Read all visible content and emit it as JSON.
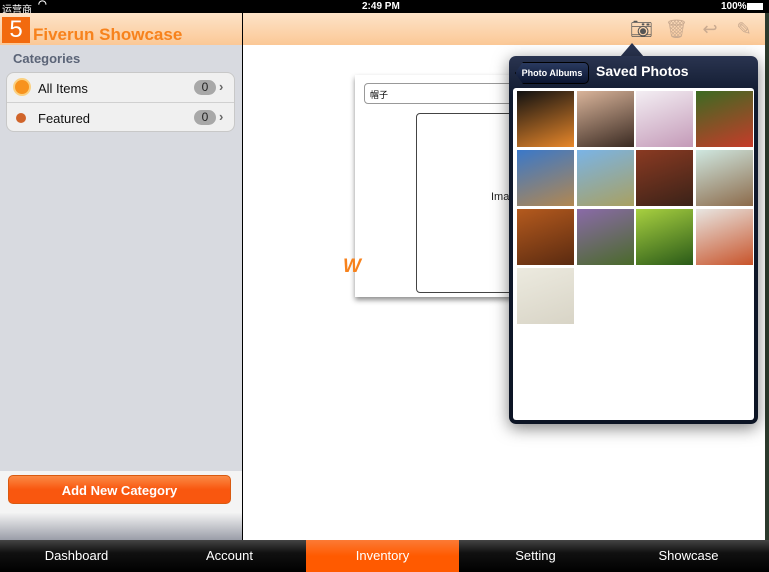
{
  "status_bar": {
    "carrier": "运营商",
    "time": "2:49 PM",
    "battery": "100%"
  },
  "sidebar": {
    "logo": "5",
    "app_title": "Fiverun Showcase",
    "section": "Categories",
    "items": [
      {
        "label": "All Items",
        "count": "0",
        "icon": "stack-icon"
      },
      {
        "label": "Featured",
        "count": "0",
        "icon": "dot-icon"
      }
    ],
    "add_button": "Add New Category"
  },
  "toolbar": {
    "icons": [
      "camera-icon",
      "trash-icon",
      "reply-icon",
      "compose-icon"
    ]
  },
  "form": {
    "name_value": "帽子",
    "image_label": "Ima",
    "logo_fragment": "W"
  },
  "photo_picker": {
    "back_label": "Photo Albums",
    "title": "Saved Photos",
    "photos": [
      {
        "colors": [
          "#111",
          "#e8872a"
        ]
      },
      {
        "colors": [
          "#d9b49a",
          "#3a2a22"
        ]
      },
      {
        "colors": [
          "#f3eef3",
          "#c49ab8"
        ]
      },
      {
        "colors": [
          "#3b6b22",
          "#c73b2a"
        ]
      },
      {
        "colors": [
          "#3a78c9",
          "#b28750"
        ]
      },
      {
        "colors": [
          "#7ab4e6",
          "#a9a060"
        ]
      },
      {
        "colors": [
          "#8a3a22",
          "#3a2218"
        ]
      },
      {
        "colors": [
          "#cfe7e0",
          "#8c6a4a"
        ]
      },
      {
        "colors": [
          "#b45a1e",
          "#5a2a10"
        ]
      },
      {
        "colors": [
          "#8a6aa8",
          "#4a6a2a"
        ]
      },
      {
        "colors": [
          "#a8d040",
          "#2a5a18"
        ]
      },
      {
        "colors": [
          "#e8e6e2",
          "#c8532a"
        ]
      },
      {
        "colors": [
          "#eceadf",
          "#d8d4c6"
        ]
      }
    ]
  },
  "tabs": [
    {
      "label": "Dashboard"
    },
    {
      "label": "Account"
    },
    {
      "label": "Inventory",
      "active": true
    },
    {
      "label": "Setting"
    },
    {
      "label": "Showcase"
    }
  ],
  "colors": {
    "accent": "#f9570f",
    "brand": "#f7821c"
  }
}
